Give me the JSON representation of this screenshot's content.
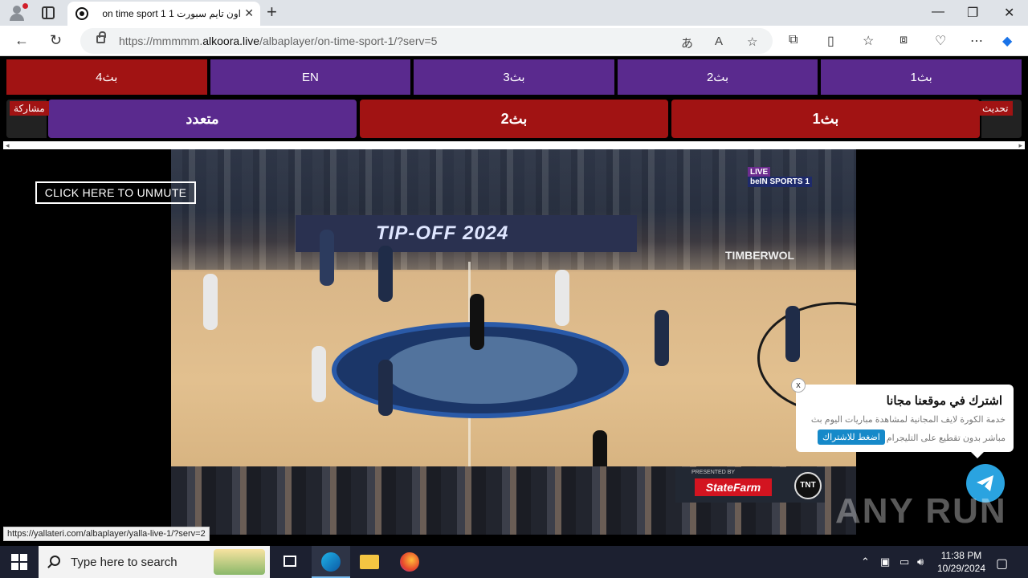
{
  "browser": {
    "tab_title": "on time sport 1 اون تايم سبورت 1",
    "url_prefix": "https://mmmmm.",
    "url_domain": "alkoora.live",
    "url_path": "/albaplayer/on-time-sport-1/?serv=5",
    "status_url": "https://yallateri.com/albaplayer/yalla-live-1/?serv=2"
  },
  "servers_row1": [
    {
      "label": "بث4",
      "active": true
    },
    {
      "label": "EN",
      "active": false
    },
    {
      "label": "بث3",
      "active": false
    },
    {
      "label": "بث2",
      "active": false
    },
    {
      "label": "بث1",
      "active": false
    }
  ],
  "servers_row2": {
    "multi": "متعدد",
    "stream2": "بث2",
    "stream1": "بث1",
    "share": "مشاركة",
    "refresh": "تحديث"
  },
  "video": {
    "unmute_label": "CLICK HERE TO UNMUTE",
    "banner_text": "TIP-OFF 2024",
    "wall_text": "TIMBERWOL",
    "channel_bug_top": "LIVE",
    "channel_bug": "beIN SPORTS 1",
    "sponsor_presented": "PRESENTED BY",
    "sponsor_name": "StateFarm",
    "sponsor_network": "TNT"
  },
  "popup": {
    "title": "اشترك في موقعنا مجانا",
    "desc_line1": "خدمة الكورة لايف المجانية لمشاهدة مباريات اليوم بث",
    "desc_line2": "مباشر بدون تقطيع على التليجرام",
    "button": "اضغط للاشتراك",
    "close": "x"
  },
  "watermark": "ANY RUN",
  "taskbar": {
    "search_placeholder": "Type here to search",
    "time": "11:38 PM",
    "date": "10/29/2024"
  },
  "colors": {
    "purple": "#5a2a8e",
    "red": "#a11313",
    "telegram": "#2aa3e0"
  }
}
